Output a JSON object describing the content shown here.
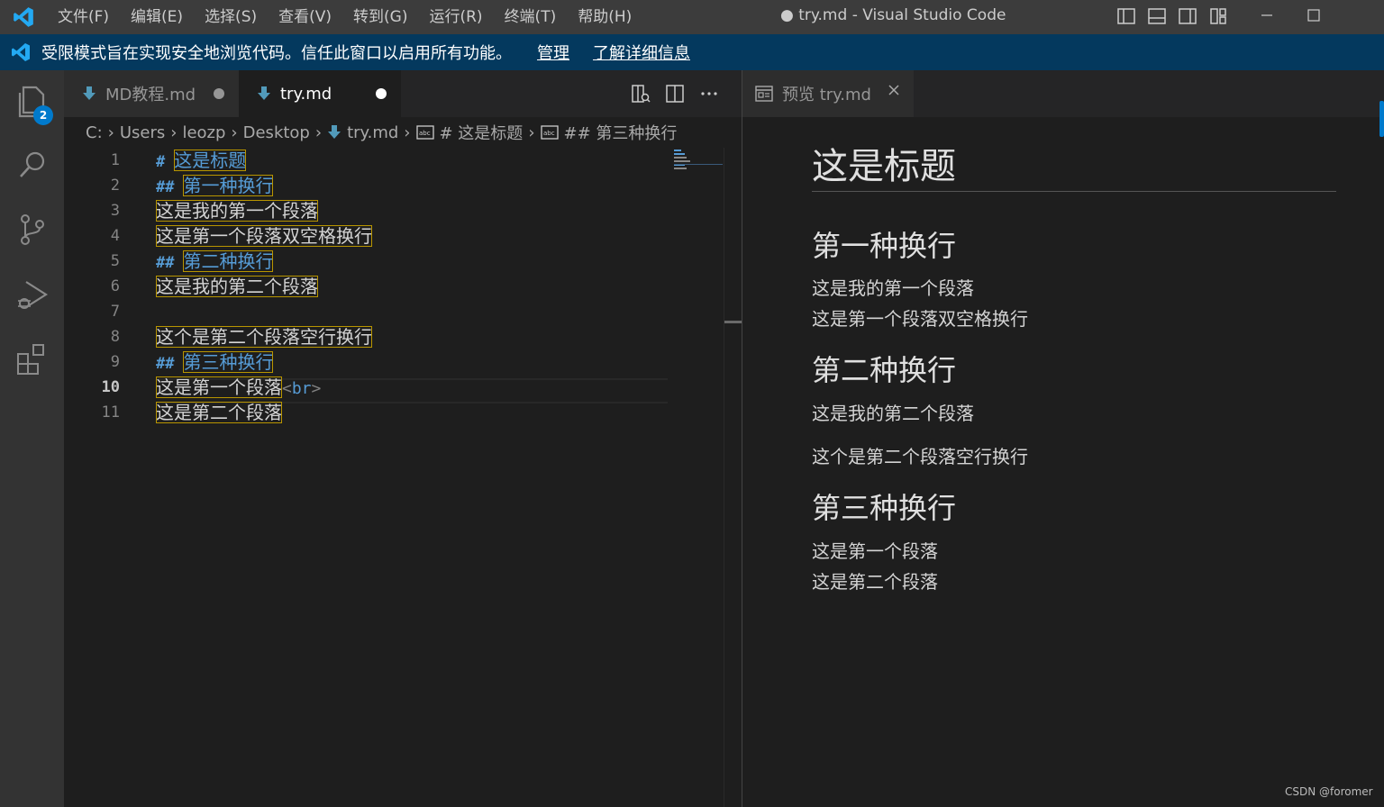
{
  "titlebar": {
    "menu": [
      "文件(F)",
      "编辑(E)",
      "选择(S)",
      "查看(V)",
      "转到(G)",
      "运行(R)",
      "终端(T)",
      "帮助(H)"
    ],
    "title": "● try.md - Visual Studio Code"
  },
  "banner": {
    "message": "受限模式旨在实现安全地浏览代码。信任此窗口以启用所有功能。",
    "manage": "管理",
    "learn_more": "了解详细信息"
  },
  "activity": {
    "explorer_badge": "2"
  },
  "editor": {
    "tabs": [
      {
        "label": "MD教程.md"
      },
      {
        "label": "try.md"
      }
    ],
    "breadcrumb": [
      "C:",
      "Users",
      "leozp",
      "Desktop",
      "try.md",
      "# 这是标题",
      "## 第三种换行"
    ],
    "lines": [
      {
        "num": "1",
        "hash": "#",
        "text": "这是标题"
      },
      {
        "num": "2",
        "hash": "##",
        "text": "第一种换行"
      },
      {
        "num": "3",
        "text": "这是我的第一个段落"
      },
      {
        "num": "4",
        "text": "这是第一个段落双空格换行"
      },
      {
        "num": "5",
        "hash": "##",
        "text": "第二种换行"
      },
      {
        "num": "6",
        "text": "这是我的第二个段落"
      },
      {
        "num": "7",
        "text": ""
      },
      {
        "num": "8",
        "text": "这个是第二个段落空行换行"
      },
      {
        "num": "9",
        "hash": "##",
        "text": "第三种换行"
      },
      {
        "num": "10",
        "text": "这是第一个段落",
        "tag_open": "<",
        "tag_name": "br",
        "tag_close": ">"
      },
      {
        "num": "11",
        "text": "这是第二个段落"
      }
    ]
  },
  "preview": {
    "tab_label": "预览 try.md",
    "h1": "这是标题",
    "sections": [
      {
        "h2": "第一种换行",
        "p1": "这是我的第一个段落",
        "p2": "这是第一个段落双空格换行"
      },
      {
        "h2": "第二种换行",
        "p1": "这是我的第二个段落",
        "p2": "这个是第二个段落空行换行"
      },
      {
        "h2": "第三种换行",
        "p1": "这是第一个段落",
        "p2": "这是第二个段落"
      }
    ]
  },
  "watermark": "CSDN @foromer",
  "colors": {
    "accent": "#007acc",
    "banner_bg": "#04395e",
    "heading_blue": "#569cd6",
    "highlight_border": "#b89500"
  }
}
